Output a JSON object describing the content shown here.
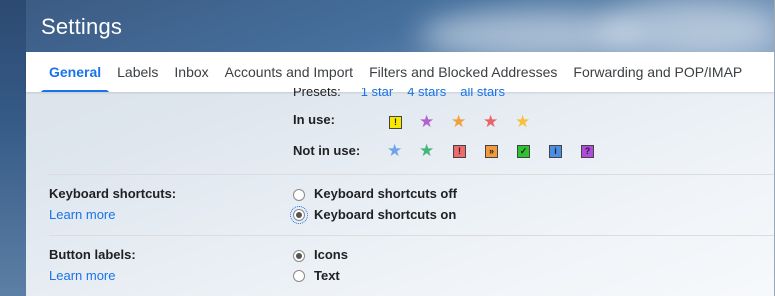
{
  "title": "Settings",
  "tabs": [
    {
      "label": "General",
      "active": true
    },
    {
      "label": "Labels"
    },
    {
      "label": "Inbox"
    },
    {
      "label": "Accounts and Import"
    },
    {
      "label": "Filters and Blocked Addresses"
    },
    {
      "label": "Forwarding and POP/IMAP"
    }
  ],
  "stars": {
    "presets_label": "Presets:",
    "presets": [
      "1 star",
      "4 stars",
      "all stars"
    ],
    "in_use_label": "In use:",
    "not_in_use_label": "Not in use:",
    "in_use": [
      {
        "type": "box",
        "glyph": "!",
        "color": "#f7e800"
      },
      {
        "type": "star",
        "color": "#b35fd1"
      },
      {
        "type": "star",
        "color": "#f2a03a"
      },
      {
        "type": "star",
        "color": "#e8646a"
      },
      {
        "type": "star",
        "color": "#f5c23d"
      }
    ],
    "not_in_use": [
      {
        "type": "star",
        "color": "#6fa3ea"
      },
      {
        "type": "star",
        "color": "#45b678"
      },
      {
        "type": "box",
        "glyph": "!",
        "color": "#ee6b6b"
      },
      {
        "type": "box",
        "glyph": "»",
        "color": "#f39a3d"
      },
      {
        "type": "box",
        "glyph": "✓",
        "color": "#2ec22e"
      },
      {
        "type": "box",
        "glyph": "i",
        "color": "#4a8fe5"
      },
      {
        "type": "box",
        "glyph": "?",
        "color": "#b04ae0"
      }
    ]
  },
  "keyboard": {
    "title": "Keyboard shortcuts:",
    "learn_more": "Learn more",
    "options": [
      {
        "label": "Keyboard shortcuts off",
        "checked": false
      },
      {
        "label": "Keyboard shortcuts on",
        "checked": true
      }
    ]
  },
  "button_labels": {
    "title": "Button labels:",
    "learn_more": "Learn more",
    "options": [
      {
        "label": "Icons",
        "checked": true
      },
      {
        "label": "Text",
        "checked": false
      }
    ]
  }
}
